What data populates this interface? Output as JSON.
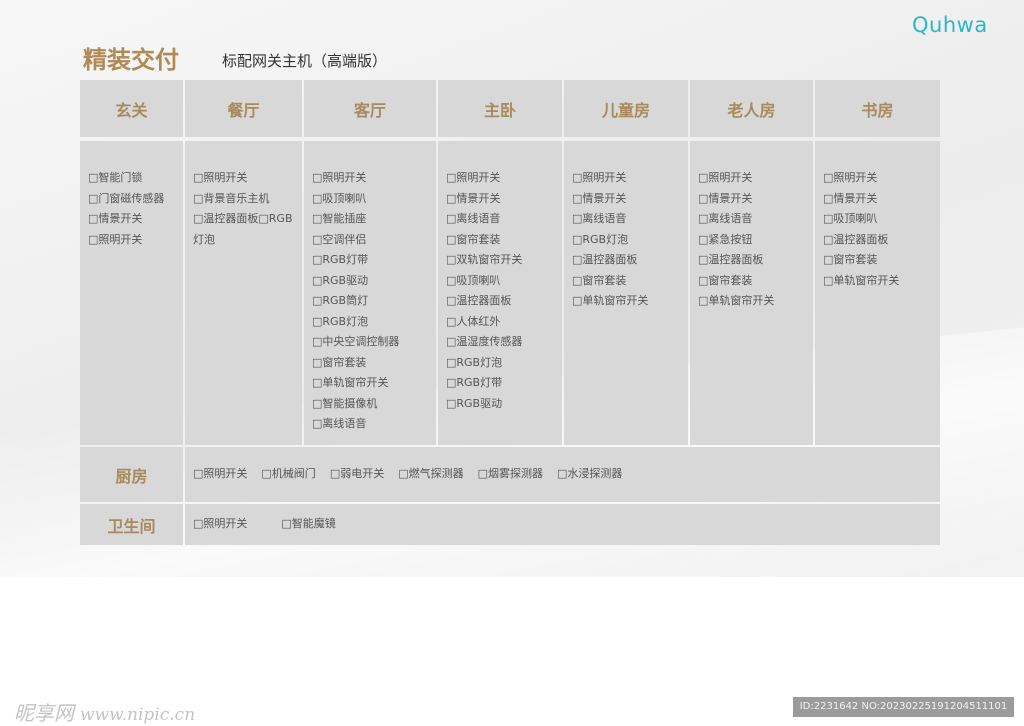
{
  "brand": {
    "logo_text": "Quhwa",
    "logo_color": "#2bb7c9"
  },
  "header": {
    "title": "精装交付",
    "subtitle": "标配网关主机（高端版）"
  },
  "colors": {
    "gold": "#a88a5c",
    "cell_bg": "#d8d8d8",
    "text": "#555555"
  },
  "rooms": [
    {
      "name": "玄关",
      "items": [
        "□智能门锁",
        "□门窗磁传感器",
        "□情景开关",
        "□照明开关"
      ]
    },
    {
      "name": "餐厅",
      "items": [
        "□照明开关",
        "□背景音乐主机",
        "□温控器面板□RGB灯泡"
      ]
    },
    {
      "name": "客厅",
      "items": [
        "□照明开关",
        "□吸顶喇叭",
        "□智能插座",
        "□空调伴侣",
        "□RGB灯带",
        "□RGB驱动",
        "□RGB筒灯",
        "□RGB灯泡",
        "□中央空调控制器",
        "□窗帘套装",
        "□单轨窗帘开关",
        "□智能摄像机",
        "□离线语音"
      ]
    },
    {
      "name": "主卧",
      "items": [
        "□照明开关",
        "□情景开关",
        "□离线语音",
        "□窗帘套装",
        "□双轨窗帘开关",
        "□吸顶喇叭",
        "□温控器面板",
        "□人体红外",
        "□温湿度传感器",
        "□RGB灯泡",
        "□RGB灯带",
        "□RGB驱动"
      ]
    },
    {
      "name": "儿童房",
      "items": [
        "□照明开关",
        "□情景开关",
        "□离线语音",
        "□RGB灯泡",
        "□温控器面板",
        "□窗帘套装",
        "□单轨窗帘开关"
      ]
    },
    {
      "name": "老人房",
      "items": [
        "□照明开关",
        "□情景开关",
        "□离线语音",
        "□紧急按钮",
        "□温控器面板",
        "□窗帘套装",
        "□单轨窗帘开关"
      ]
    },
    {
      "name": "书房",
      "items": [
        "□照明开关",
        "□情景开关",
        "□吸顶喇叭",
        "□温控器面板",
        "□窗帘套装",
        "□单轨窗帘开关"
      ]
    }
  ],
  "extra_rows": [
    {
      "name": "厨房",
      "items": [
        "□照明开关",
        "□机械阀门",
        "□弱电开关",
        "□燃气探测器",
        "□烟雾探测器",
        "□水浸探测器"
      ]
    },
    {
      "name": "卫生间",
      "items": [
        "□照明开关",
        "□智能魔镜"
      ]
    }
  ],
  "watermark": {
    "site": "昵享网",
    "url": "www.nipic.cn",
    "id_text": "ID:2231642 NO:20230225191204511101"
  }
}
